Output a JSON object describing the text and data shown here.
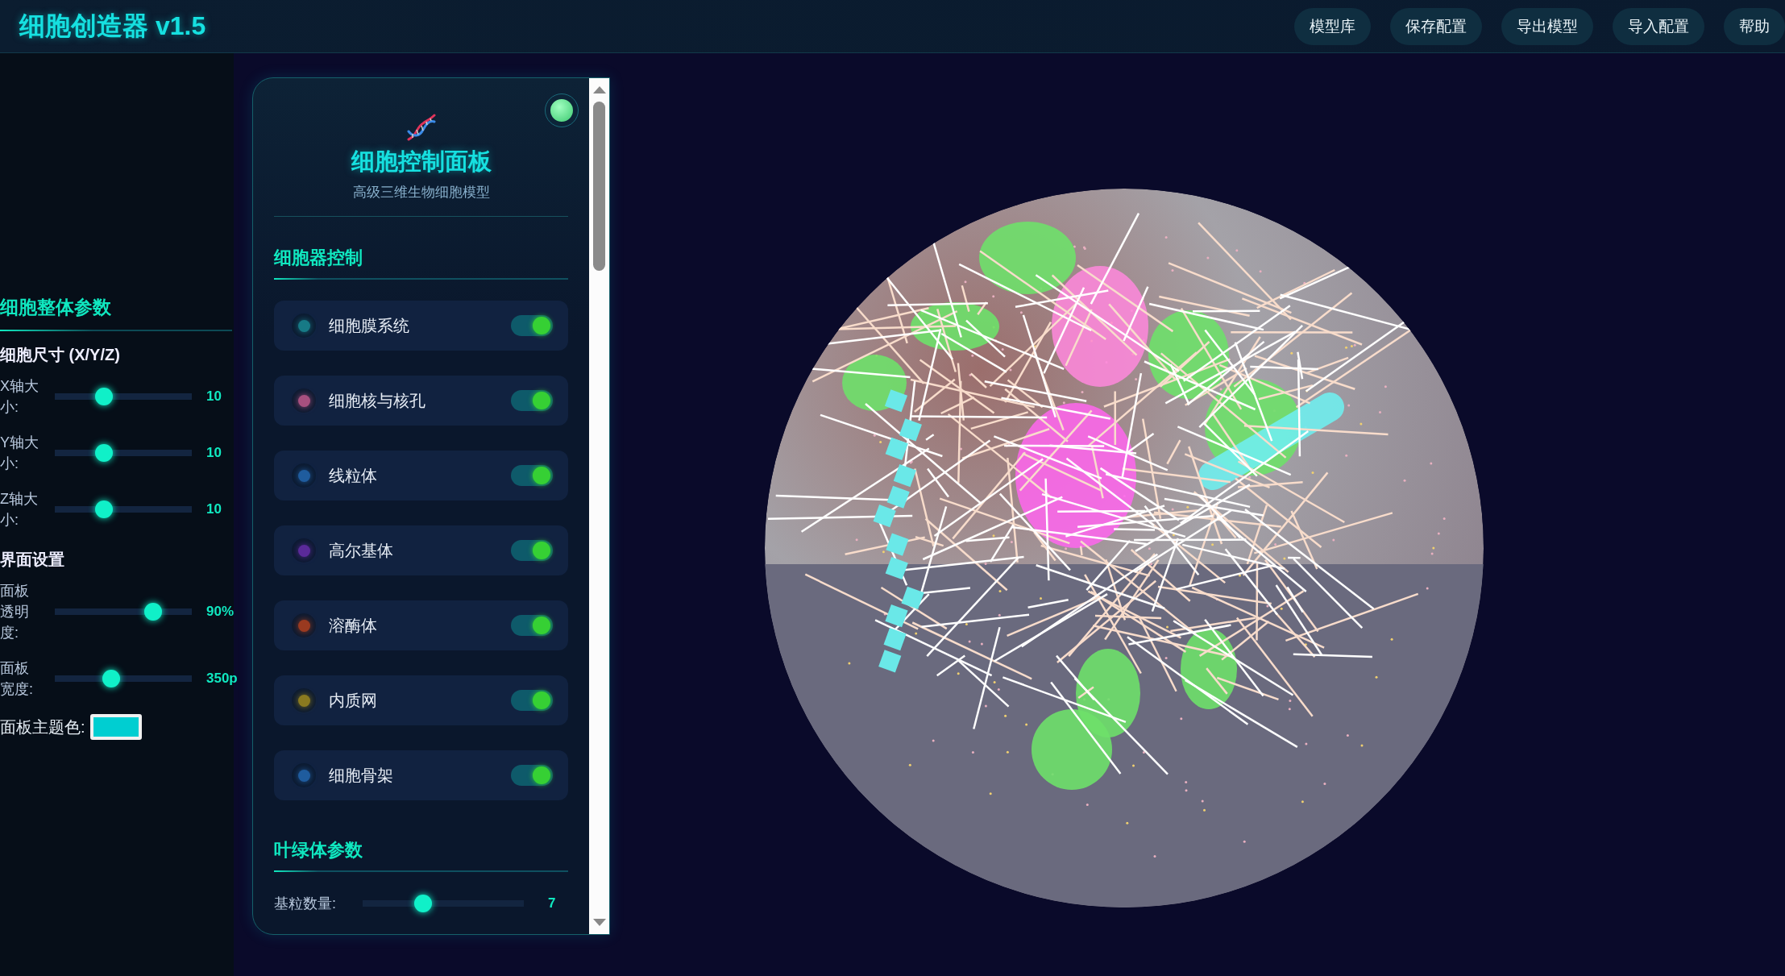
{
  "header": {
    "title": "细胞创造器 v1.5",
    "buttons": [
      "模型库",
      "保存配置",
      "导出模型",
      "导入配置",
      "帮助"
    ]
  },
  "sidebar": {
    "title": "细胞整体参数",
    "groups": [
      {
        "title": "细胞尺寸 (X/Y/Z)",
        "sliders": [
          {
            "label": "X轴大小:",
            "level": 0.34,
            "value": "10"
          },
          {
            "label": "Y轴大小:",
            "level": 0.34,
            "value": "10"
          },
          {
            "label": "Z轴大小:",
            "level": 0.34,
            "value": "10"
          }
        ]
      },
      {
        "title": "界面设置",
        "sliders": [
          {
            "label": "面板透明度:",
            "level": 0.75,
            "value": "90%"
          },
          {
            "label": "面板宽度:",
            "level": 0.4,
            "value": "350p"
          }
        ]
      }
    ],
    "color_picker": {
      "label": "面板主题色:",
      "color": "#00ced1"
    }
  },
  "panel": {
    "title": "细胞控制面板",
    "subtitle": "高级三维生物细胞模型",
    "organelle_section": {
      "title": "细胞器控制",
      "items": [
        {
          "label": "细胞膜系统",
          "color": "#177a86",
          "on": true
        },
        {
          "label": "细胞核与核孔",
          "color": "#a8507f",
          "on": true
        },
        {
          "label": "线粒体",
          "color": "#1f5c9e",
          "on": true
        },
        {
          "label": "高尔基体",
          "color": "#5a2a9a",
          "on": true
        },
        {
          "label": "溶酶体",
          "color": "#9a3a20",
          "on": true
        },
        {
          "label": "内质网",
          "color": "#8a7a20",
          "on": true
        },
        {
          "label": "细胞骨架",
          "color": "#1f5c9e",
          "on": true
        }
      ]
    },
    "chloroplast_section": {
      "title": "叶绿体参数",
      "sliders": [
        {
          "label": "基粒数量:",
          "level": 0.36,
          "value": "7"
        }
      ]
    }
  }
}
